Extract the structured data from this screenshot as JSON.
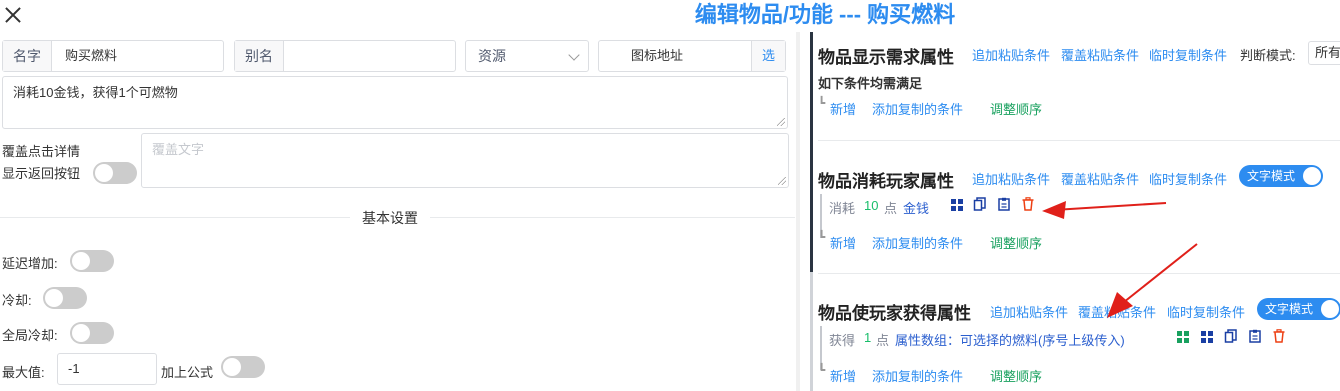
{
  "title": "编辑物品/功能 --- 购买燃料",
  "form": {
    "name_label": "名字",
    "name_value": "购买燃料",
    "alias_label": "别名",
    "alias_value": "",
    "source_select": "资源",
    "icon_placeholder": "图标地址",
    "icon_pick": "选",
    "description": "消耗10金钱，获得1个可燃物",
    "override_detail_label": "覆盖点击详情",
    "show_back_label": "显示返回按钮",
    "override_placeholder": "覆盖文字",
    "basic_settings": "基本设置",
    "delay_label": "延迟增加:",
    "cooldown_label": "冷却:",
    "global_cooldown_label": "全局冷却:",
    "max_label": "最大值:",
    "max_value": "-1",
    "add_formula_label": "加上公式"
  },
  "sections": {
    "display": {
      "title": "物品显示需求属性",
      "add_paste": "追加粘贴条件",
      "override_paste": "覆盖粘贴条件",
      "temp_copy": "临时复制条件",
      "judge_mode_label": "判断模式:",
      "judge_mode_value": "所有",
      "subtitle": "如下条件均需满足",
      "new": "新增",
      "add_copied": "添加复制的条件",
      "adjust_order": "调整顺序"
    },
    "consume": {
      "title": "物品消耗玩家属性",
      "add_paste": "追加粘贴条件",
      "override_paste": "覆盖粘贴条件",
      "temp_copy": "临时复制条件",
      "mode": "文字模式",
      "item_prefix": "消耗",
      "item_amount": "10",
      "item_unit": "点",
      "item_target": "金钱",
      "new": "新增",
      "add_copied": "添加复制的条件",
      "adjust_order": "调整顺序"
    },
    "gain": {
      "title": "物品使玩家获得属性",
      "add_paste": "追加粘贴条件",
      "override_paste": "覆盖粘贴条件",
      "temp_copy": "临时复制条件",
      "mode": "文字模式",
      "item_prefix": "获得",
      "item_amount": "1",
      "item_unit": "点",
      "item_target": "属性数组：可选择的燃料(序号上级传入)",
      "new": "新增",
      "add_copied": "添加复制的条件",
      "adjust_order": "调整顺序"
    }
  },
  "colors": {
    "accent": "#2d8cf0",
    "green": "#19be6b",
    "danger": "#ed4014",
    "arrow": "#e0201a"
  }
}
